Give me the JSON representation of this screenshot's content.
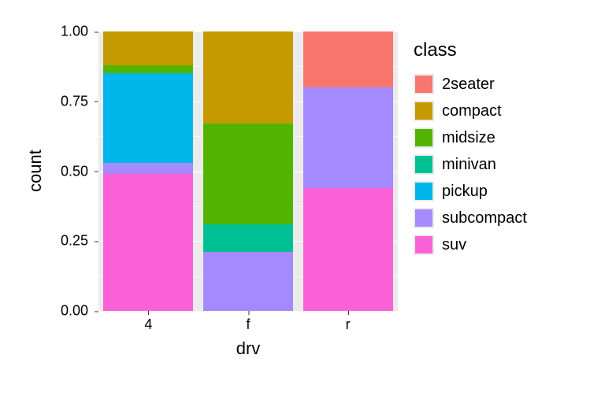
{
  "chart_data": {
    "type": "bar",
    "stacked": true,
    "normalized": true,
    "title": "",
    "xlabel": "drv",
    "ylabel": "count",
    "ylim": [
      0,
      1
    ],
    "yticks": [
      0.0,
      0.25,
      0.5,
      0.75,
      1.0
    ],
    "ytick_labels": [
      "0.00",
      "0.25",
      "0.50",
      "0.75",
      "1.00"
    ],
    "categories": [
      "4",
      "f",
      "r"
    ],
    "legend_title": "class",
    "series": [
      {
        "name": "2seater",
        "color": "#F8766D",
        "values": [
          0.0,
          0.0,
          0.2
        ]
      },
      {
        "name": "compact",
        "color": "#C49A00",
        "values": [
          0.12,
          0.33,
          0.0
        ]
      },
      {
        "name": "midsize",
        "color": "#53B400",
        "values": [
          0.03,
          0.36,
          0.0
        ]
      },
      {
        "name": "minivan",
        "color": "#00C094",
        "values": [
          0.0,
          0.1,
          0.0
        ]
      },
      {
        "name": "pickup",
        "color": "#00B6EB",
        "values": [
          0.32,
          0.0,
          0.0
        ]
      },
      {
        "name": "subcompact",
        "color": "#A58AFF",
        "values": [
          0.04,
          0.21,
          0.36
        ]
      },
      {
        "name": "suv",
        "color": "#FB61D7",
        "values": [
          0.49,
          0.0,
          0.44
        ]
      }
    ]
  }
}
